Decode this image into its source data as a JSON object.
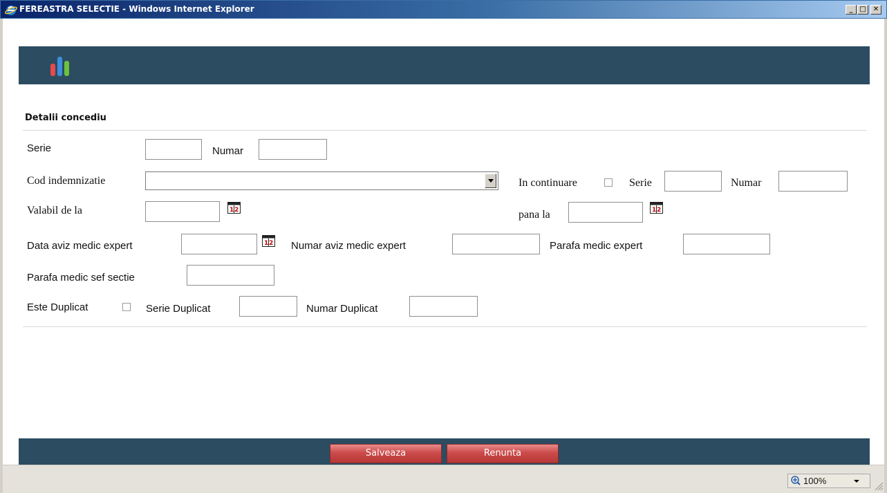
{
  "window": {
    "title": "FEREASTRA SELECTIE - Windows Internet Explorer",
    "minimize": "_",
    "maximize": "□",
    "close": "✕"
  },
  "section": {
    "title": "Detalii concediu"
  },
  "form": {
    "serie_label": "Serie",
    "numar_label": "Numar",
    "cod_indemnizatie_label": "Cod indemnizatie",
    "cod_indemnizatie_value": "",
    "in_continuare_label": "In continuare",
    "serie_continuare_label": "Serie",
    "numar_continuare_label": "Numar",
    "valabil_de_la_label": "Valabil de la",
    "pana_la_label": "pana la",
    "data_aviz_label": "Data aviz medic expert",
    "numar_aviz_label": "Numar aviz medic expert",
    "parafa_expert_label": "Parafa medic expert",
    "parafa_sef_label": "Parafa medic sef sectie",
    "este_duplicat_label": "Este Duplicat",
    "serie_duplicat_label": "Serie Duplicat",
    "numar_duplicat_label": "Numar Duplicat"
  },
  "buttons": {
    "save": "Salveaza",
    "cancel": "Renunta"
  },
  "status": {
    "zoom": "100%"
  },
  "colors": {
    "band": "#2c4c61",
    "button": "#cc4b4b"
  }
}
